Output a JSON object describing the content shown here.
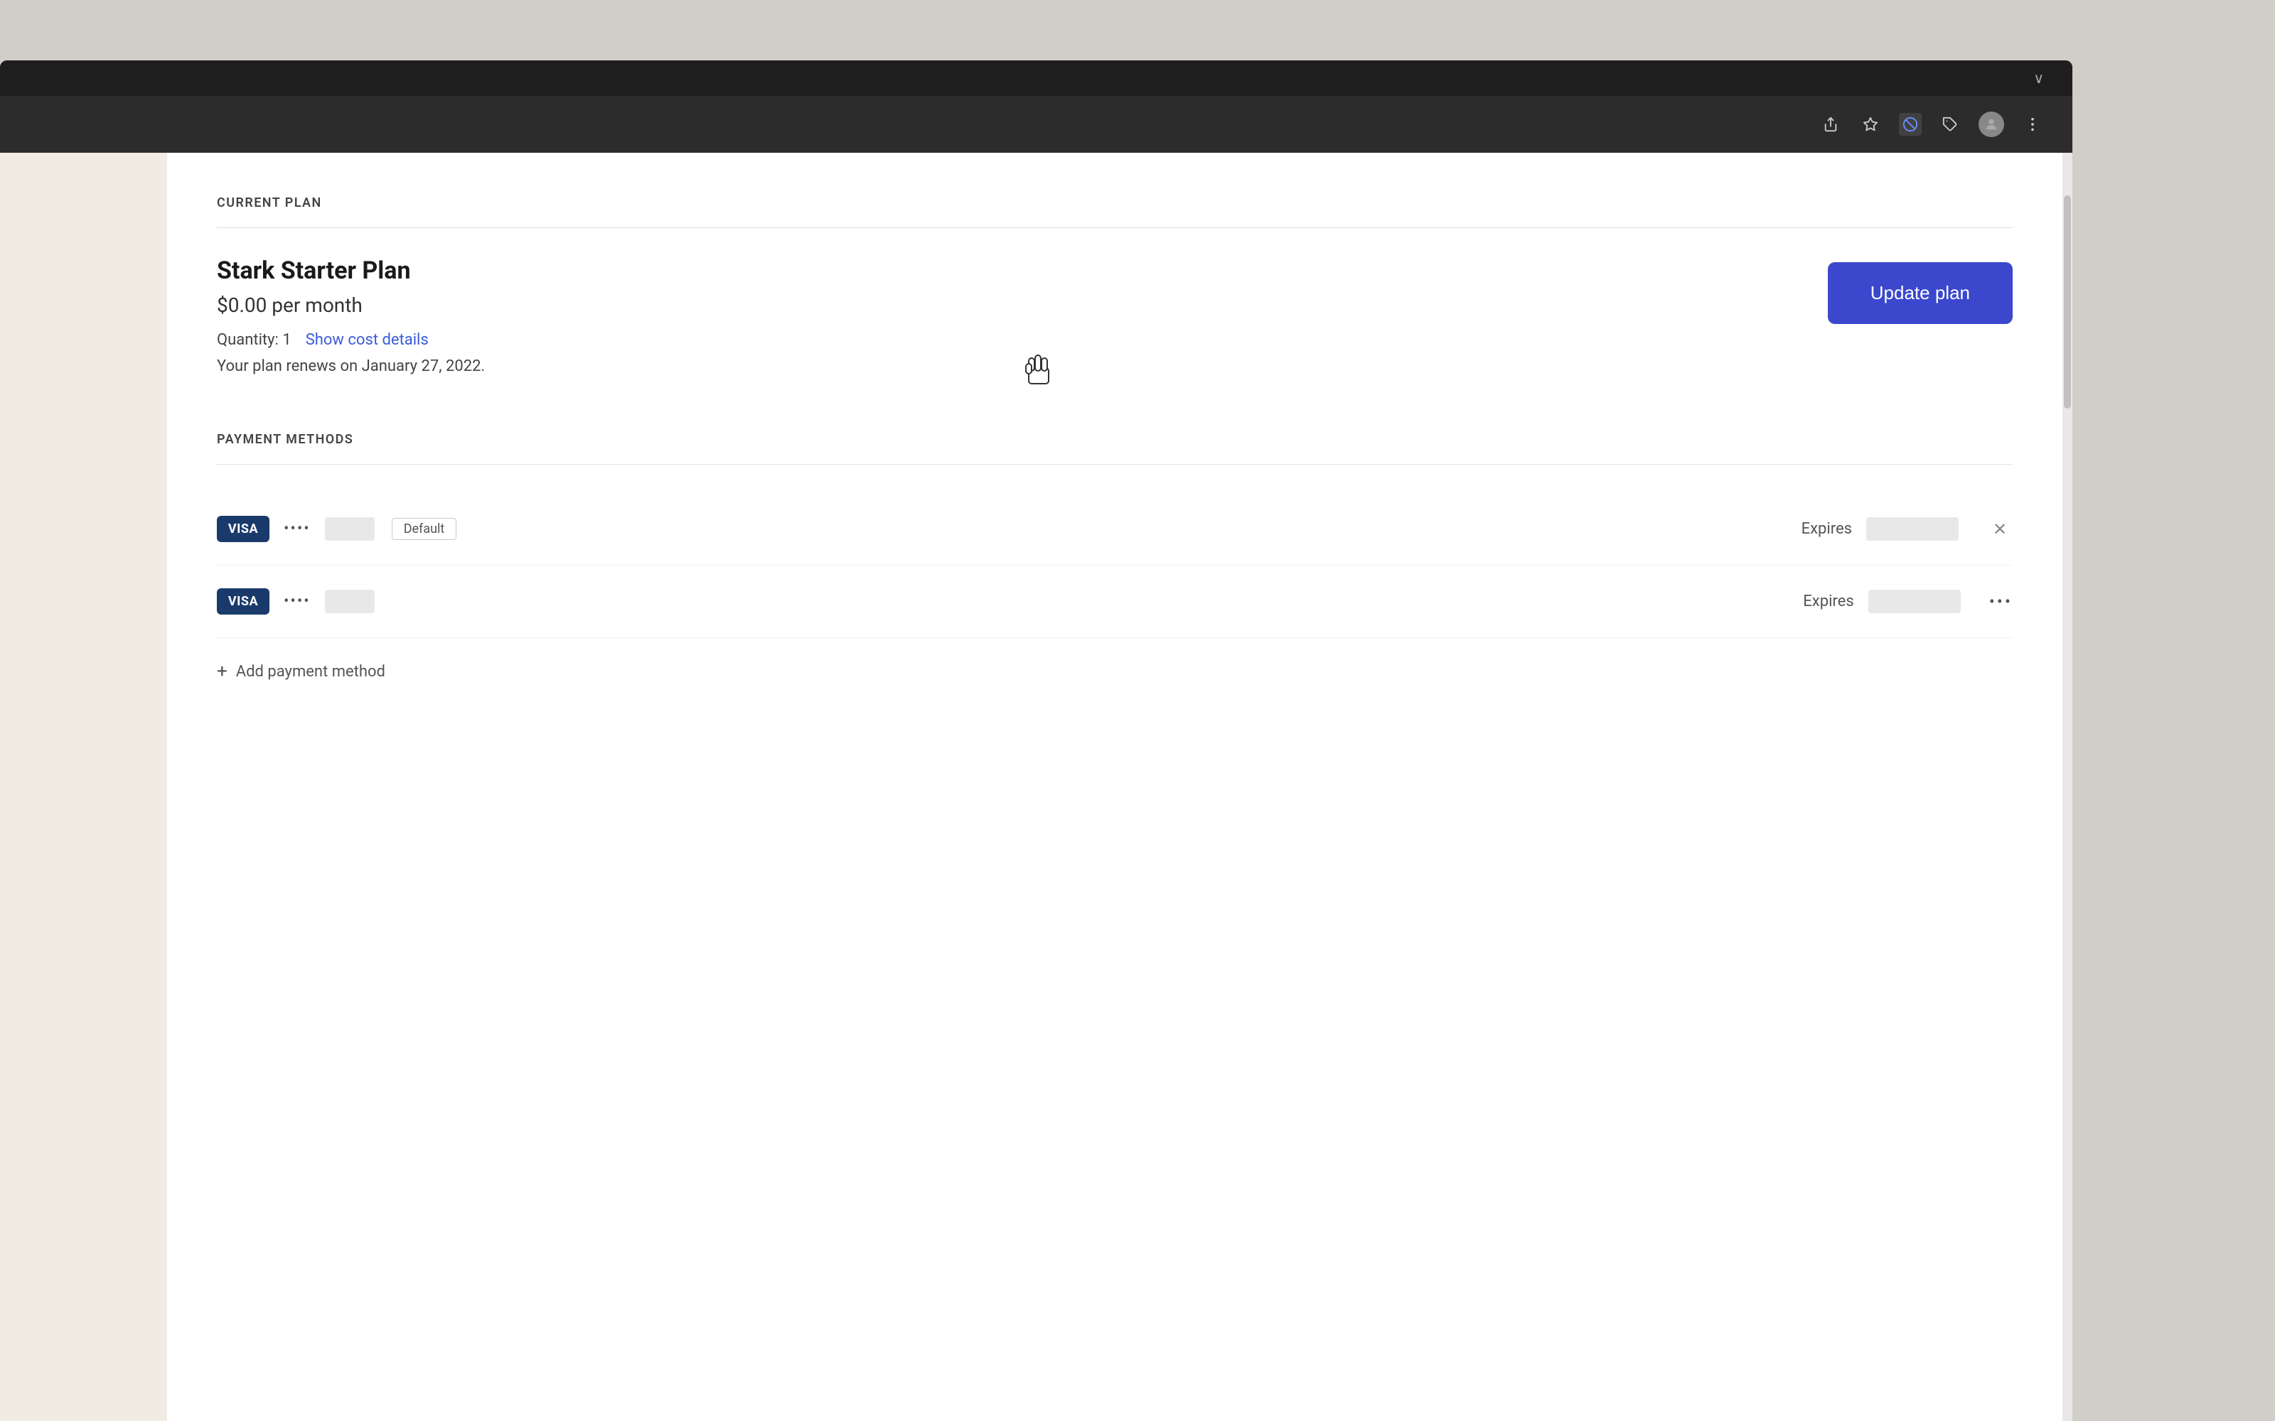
{
  "browser": {
    "toolbar": {
      "share_icon": "⬆",
      "bookmark_icon": "☆",
      "active_icon": "⊘",
      "extensions_icon": "🧩",
      "more_icon": "⋮",
      "chevron_down": "∨"
    }
  },
  "current_plan": {
    "section_label": "CURRENT PLAN",
    "plan_name": "Stark Starter Plan",
    "plan_price": "$0.00 per month",
    "quantity_label": "Quantity: 1",
    "show_cost_details_label": "Show cost details",
    "renew_label": "Your plan renews on January 27, 2022.",
    "update_plan_btn": "Update plan"
  },
  "payment_methods": {
    "section_label": "PAYMENT METHODS",
    "cards": [
      {
        "brand": "VISA",
        "dots": "••••",
        "last_four": "",
        "is_default": true,
        "default_label": "Default",
        "expires_label": "Expires",
        "expires_date": ""
      },
      {
        "brand": "VISA",
        "dots": "••••",
        "last_four": "",
        "is_default": false,
        "default_label": "",
        "expires_label": "Expires",
        "expires_date": ""
      }
    ],
    "add_payment_label": "Add payment method"
  }
}
